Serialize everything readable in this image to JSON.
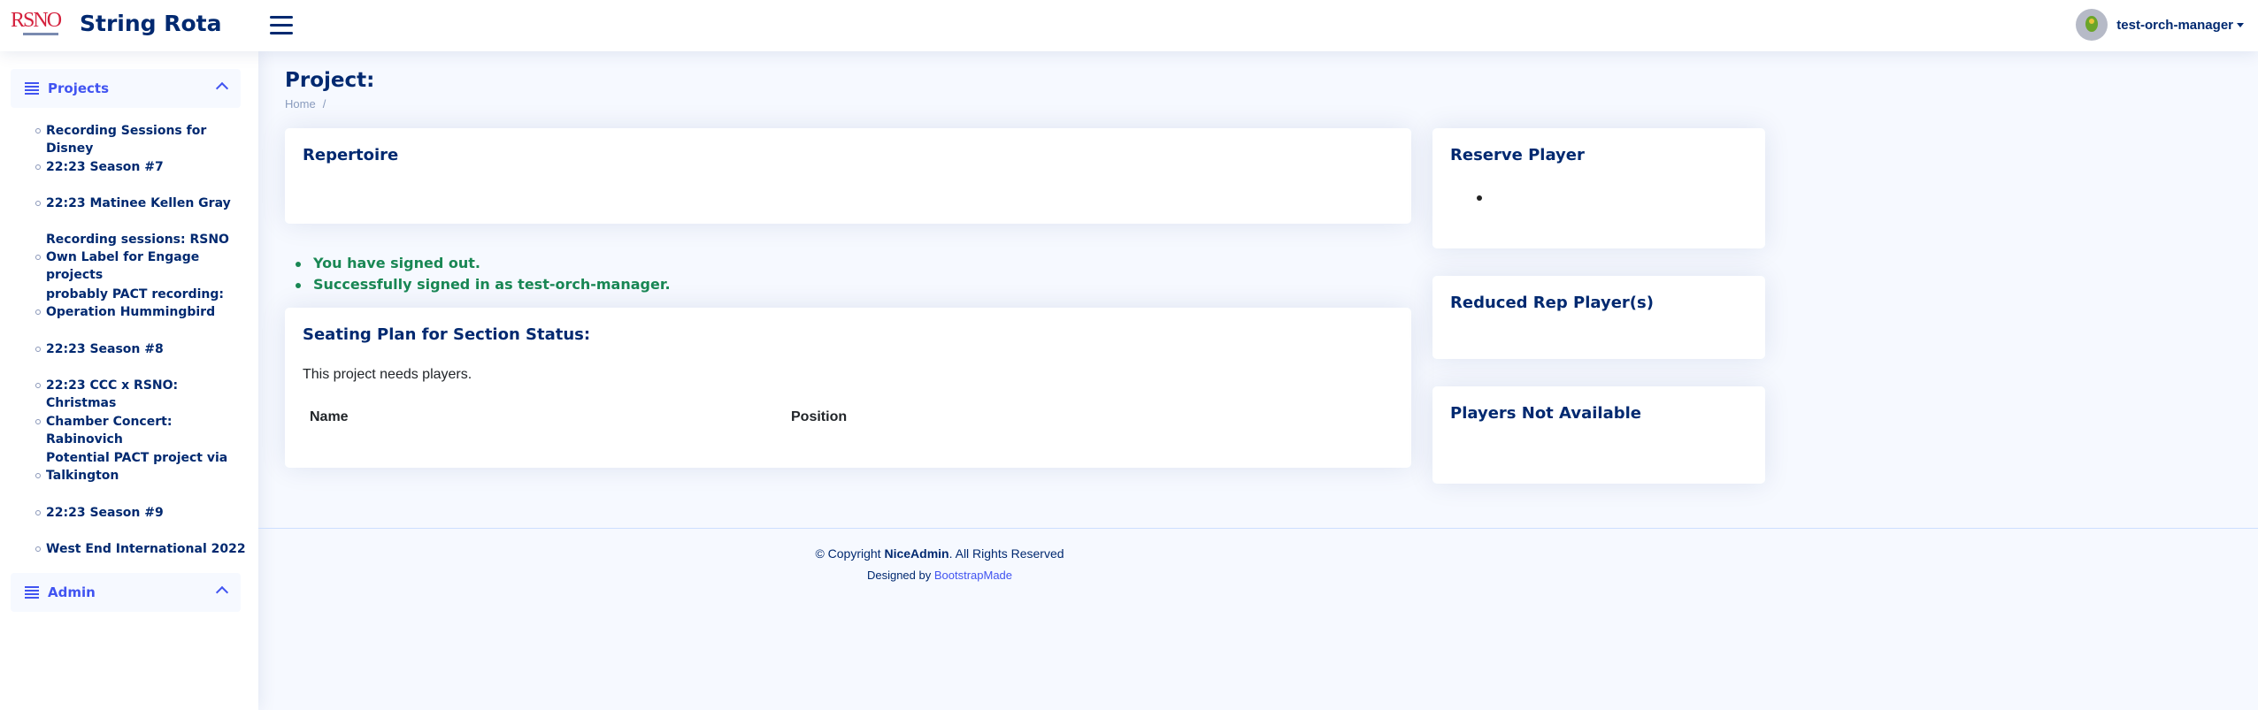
{
  "app": {
    "title": "String Rota",
    "logo_text": "RSNO"
  },
  "header": {
    "menu_icon": "hamburger-icon",
    "user": "test-orch-manager"
  },
  "sidebar": {
    "projects_label": "Projects",
    "projects": [
      {
        "label": "Recording Sessions for Disney"
      },
      {
        "label": "22:23 Season #7"
      },
      {
        "label": "22:23 Matinee Kellen Gray"
      },
      {
        "line1": "Recording sessions: RSNO",
        "line2": "Own Label for Engage projects"
      },
      {
        "line1": "probably PACT recording:",
        "line2": "Operation Hummingbird"
      },
      {
        "label": "22:23 Season #8"
      },
      {
        "label": "22:23 CCC x RSNO: Christmas"
      },
      {
        "label": "Chamber Concert: Rabinovich"
      },
      {
        "line1": "Potential PACT project via",
        "line2": "Talkington"
      },
      {
        "label": "22:23 Season #9"
      },
      {
        "label": "West End International 2022"
      }
    ],
    "admin_label": "Admin"
  },
  "main": {
    "page_title": "Project:",
    "breadcrumb": {
      "home": "Home",
      "sep": "/"
    },
    "repertoire_title": "Repertoire",
    "messages": [
      "You have signed out.",
      "Successfully signed in as test-orch-manager."
    ],
    "seating": {
      "title": "Seating Plan for Section Status:",
      "needs_text": "This project needs players.",
      "col_name": "Name",
      "col_position": "Position"
    },
    "reserve_title": "Reserve Player",
    "reduced_title": "Reduced Rep Player(s)",
    "not_available_title": "Players Not Available"
  },
  "footer": {
    "copy_prefix": "© Copyright ",
    "brand": "NiceAdmin",
    "copy_suffix": ". All Rights Reserved",
    "designed_by": "Designed by ",
    "designer": "BootstrapMade"
  },
  "colors": {
    "primary": "#012970",
    "accent": "#4154f1",
    "success": "#198754",
    "background": "#f6f9ff"
  }
}
